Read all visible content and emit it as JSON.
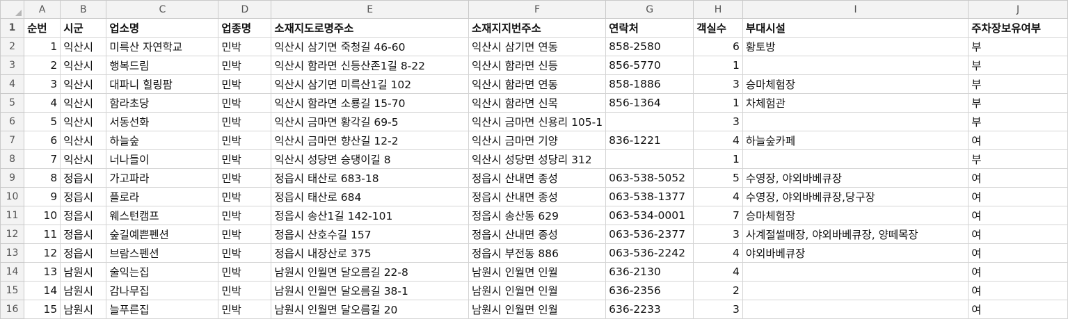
{
  "columns": [
    "A",
    "B",
    "C",
    "D",
    "E",
    "F",
    "G",
    "H",
    "I",
    "J"
  ],
  "row_numbers": [
    "1",
    "2",
    "3",
    "4",
    "5",
    "6",
    "7",
    "8",
    "9",
    "10",
    "11",
    "12",
    "13",
    "14",
    "15",
    "16"
  ],
  "header": {
    "seq": "순번",
    "city": "시군",
    "name": "업소명",
    "type": "업종명",
    "road_addr": "소재지도로명주소",
    "lot_addr": "소재지지번주소",
    "phone": "연락처",
    "rooms": "객실수",
    "facilities": "부대시설",
    "parking": "주차장보유여부"
  },
  "rows": [
    {
      "seq": "1",
      "city": "익산시",
      "name": "미륵산 자연학교",
      "type": "민박",
      "road_addr": "익산시 삼기면 죽청길 46-60",
      "lot_addr": "익산시 삼기면 연동",
      "phone": "858-2580",
      "rooms": "6",
      "facilities": "황토방",
      "parking": "부"
    },
    {
      "seq": "2",
      "city": "익산시",
      "name": "행복드림",
      "type": "민박",
      "road_addr": "익산시 함라면 신등산존1길 8-22",
      "lot_addr": "익산시 함라면 신등",
      "phone": "856-5770",
      "rooms": "1",
      "facilities": "",
      "parking": "부"
    },
    {
      "seq": "3",
      "city": "익산시",
      "name": "대파니 힐링팜",
      "type": "민박",
      "road_addr": "익산시 삼기면 미륵산1길 102",
      "lot_addr": "익산시 함라면 연동",
      "phone": "858-1886",
      "rooms": "3",
      "facilities": "승마체험장",
      "parking": "부"
    },
    {
      "seq": "4",
      "city": "익산시",
      "name": "함라초당",
      "type": "민박",
      "road_addr": "익산시 함라면 소룡길 15-70",
      "lot_addr": "익산시 함라면 신목",
      "phone": "856-1364",
      "rooms": "1",
      "facilities": "차체험관",
      "parking": "부"
    },
    {
      "seq": "5",
      "city": "익산시",
      "name": "서동선화",
      "type": "민박",
      "road_addr": "익산시 금마면 황각길 69-5",
      "lot_addr": "익산시 금마면 신용리 105-1",
      "phone": "",
      "rooms": "3",
      "facilities": "",
      "parking": "부"
    },
    {
      "seq": "6",
      "city": "익산시",
      "name": "하늘숲",
      "type": "민박",
      "road_addr": "익산시 금마면 향산길 12-2",
      "lot_addr": "익산시 금마면 기양",
      "phone": "836-1221",
      "rooms": "4",
      "facilities": "하늘숲카페",
      "parking": "여"
    },
    {
      "seq": "7",
      "city": "익산시",
      "name": "너나들이",
      "type": "민박",
      "road_addr": "익산시 성당면 승댕이길 8",
      "lot_addr": "익산시 성당면 성당리 312",
      "phone": "",
      "rooms": "1",
      "facilities": "",
      "parking": "부"
    },
    {
      "seq": "8",
      "city": "정읍시",
      "name": "가고파라",
      "type": "민박",
      "road_addr": "정읍시 태산로 683-18",
      "lot_addr": "정읍시 산내면 종성",
      "phone": "063-538-5052",
      "rooms": "5",
      "facilities": "수영장, 야외바베큐장",
      "parking": "여"
    },
    {
      "seq": "9",
      "city": "정읍시",
      "name": "플로라",
      "type": "민박",
      "road_addr": "정읍시 태산로 684",
      "lot_addr": "정읍시 산내면 종성",
      "phone": "063-538-1377",
      "rooms": "4",
      "facilities": "수영장, 야외바베큐장,당구장",
      "parking": "여"
    },
    {
      "seq": "10",
      "city": "정읍시",
      "name": "웨스턴캠프",
      "type": "민박",
      "road_addr": "정읍시 송산1길 142-101",
      "lot_addr": "정읍시 송산동 629",
      "phone": "063-534-0001",
      "rooms": "7",
      "facilities": "승마체험장",
      "parking": "여"
    },
    {
      "seq": "11",
      "city": "정읍시",
      "name": "숲길예쁜펜션",
      "type": "민박",
      "road_addr": "정읍시 산호수길 157",
      "lot_addr": "정읍시 산내면 종성",
      "phone": "063-536-2377",
      "rooms": "3",
      "facilities": "사계절썰매장, 야외바베큐장, 양떼목장",
      "parking": "여"
    },
    {
      "seq": "12",
      "city": "정읍시",
      "name": "브람스펜션",
      "type": "민박",
      "road_addr": "정읍시 내장산로 375",
      "lot_addr": "정읍시 부전동 886",
      "phone": "063-536-2242",
      "rooms": "4",
      "facilities": "야외바베큐장",
      "parking": "여"
    },
    {
      "seq": "13",
      "city": "남원시",
      "name": "술익는집",
      "type": "민박",
      "road_addr": "남원시 인월면 달오름길 22-8",
      "lot_addr": "남원시 인월면 인월",
      "phone": "636-2130",
      "rooms": "4",
      "facilities": "",
      "parking": "여"
    },
    {
      "seq": "14",
      "city": "남원시",
      "name": "감나무집",
      "type": "민박",
      "road_addr": "남원시 인월면 달오름길 38-1",
      "lot_addr": "남원시 인월면 인월",
      "phone": "636-2356",
      "rooms": "2",
      "facilities": "",
      "parking": "여"
    },
    {
      "seq": "15",
      "city": "남원시",
      "name": "늘푸른집",
      "type": "민박",
      "road_addr": "남원시 인월면 달오름길 20",
      "lot_addr": "남원시 인월면 인월",
      "phone": "636-2233",
      "rooms": "3",
      "facilities": "",
      "parking": "여"
    }
  ]
}
